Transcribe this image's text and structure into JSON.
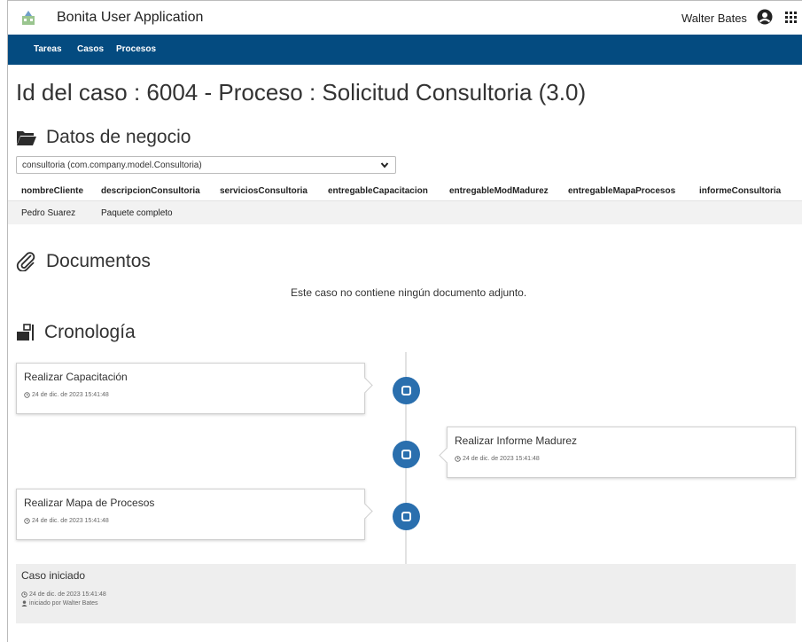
{
  "app": {
    "title": "Bonita User Application",
    "user": "Walter Bates"
  },
  "nav": {
    "tasks": "Tareas",
    "cases": "Casos",
    "processes": "Procesos"
  },
  "page": {
    "title": "Id del caso : 6004 - Proceso : Solicitud Consultoria (3.0)"
  },
  "business": {
    "heading": "Datos de negocio",
    "select_value": "consultoria (com.company.model.Consultoria)",
    "columns": [
      "nombreCliente",
      "descripcionConsultoria",
      "serviciosConsultoria",
      "entregableCapacitacion",
      "entregableModMadurez",
      "entregableMapaProcesos",
      "informeConsultoria"
    ],
    "row": [
      "Pedro Suarez",
      "Paquete completo"
    ]
  },
  "documents": {
    "heading": "Documentos",
    "empty_text": "Este caso no contiene ningún documento adjunto."
  },
  "timeline": {
    "heading": "Cronología",
    "events": [
      {
        "title": "Realizar Capacitación",
        "date": "24 de dic. de 2023 15:41:48"
      },
      {
        "title": "Realizar Informe Madurez",
        "date": "24 de dic. de 2023 15:41:48"
      },
      {
        "title": "Realizar Mapa de Procesos",
        "date": "24 de dic. de 2023 15:41:48"
      }
    ],
    "started": {
      "title": "Caso iniciado",
      "date": "24 de dic. de 2023 15:41:48",
      "by": "iniciado por Walter Bates"
    }
  },
  "colors": {
    "navbar": "#044b80",
    "timeline_dot": "#2a6fae"
  }
}
